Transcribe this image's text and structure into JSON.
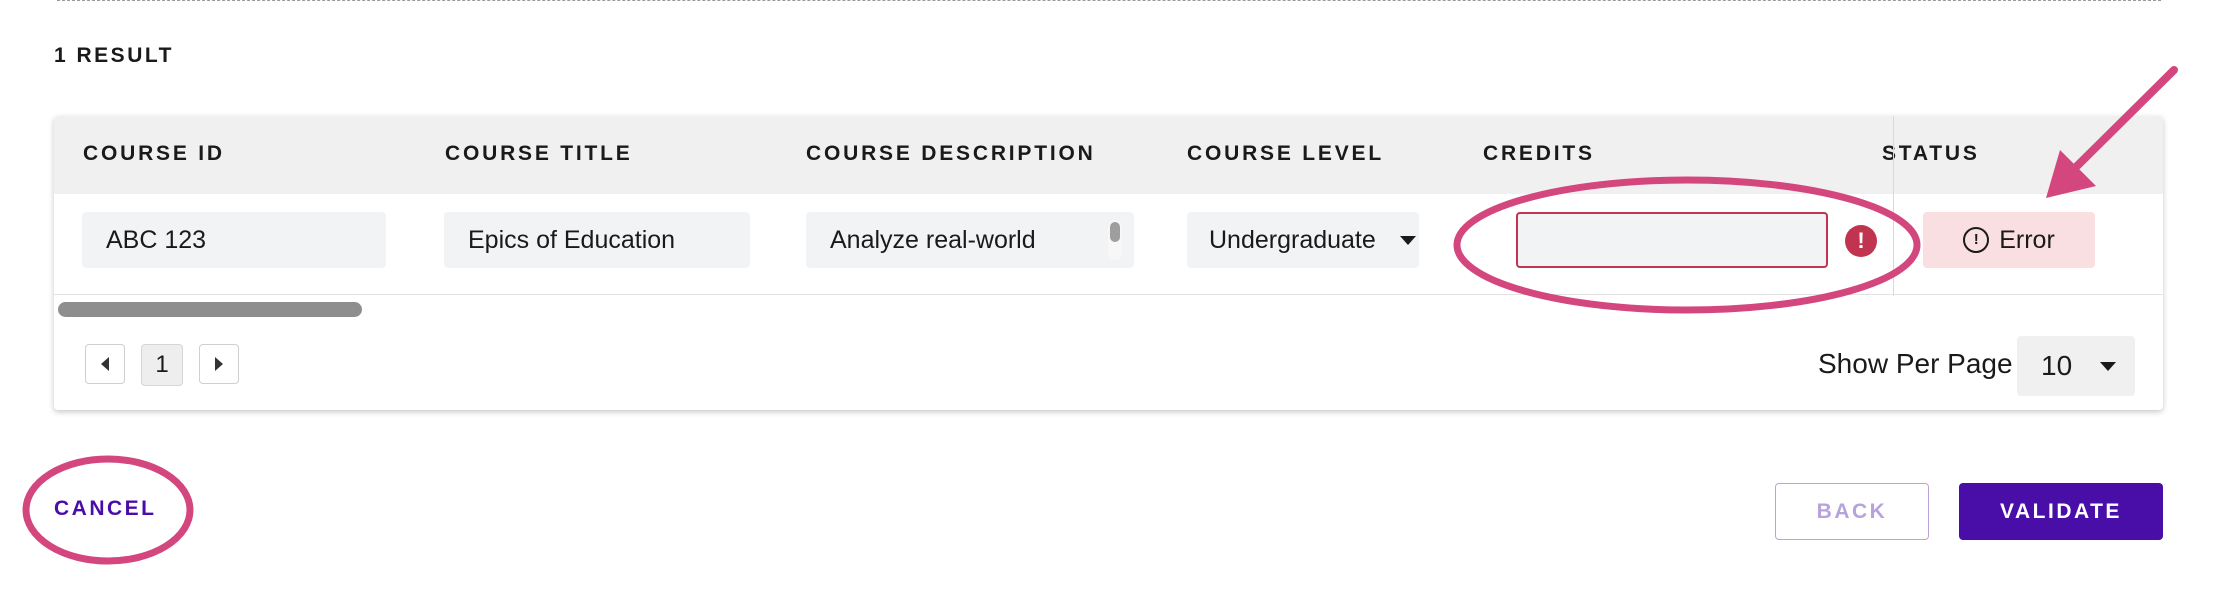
{
  "results": {
    "count_label": "1 RESULT"
  },
  "table": {
    "headers": [
      "COURSE ID",
      "COURSE TITLE",
      "COURSE DESCRIPTION",
      "COURSE LEVEL",
      "CREDITS",
      "STATUS"
    ],
    "row": {
      "course_id": "ABC 123",
      "course_title": "Epics of Education",
      "course_description": "Analyze real-world",
      "course_level": "Undergraduate",
      "credits": "",
      "credits_error_icon": "!",
      "status": "Error",
      "status_icon": "!"
    }
  },
  "pagination": {
    "current_page": "1",
    "per_page_label": "Show Per Page",
    "per_page_value": "10"
  },
  "actions": {
    "cancel": "CANCEL",
    "back": "BACK",
    "validate": "VALIDATE"
  },
  "colors": {
    "accent_purple": "#4a0ea8",
    "error_red": "#c0344f",
    "error_chip_bg": "#f9dfe1",
    "annotation_pink": "#d4467e"
  },
  "icons": {
    "pager_prev": "caret-left-icon",
    "pager_next": "caret-right-icon",
    "dropdown": "chevron-down-icon",
    "error": "error-alert-icon",
    "status": "alert-circle-icon"
  }
}
